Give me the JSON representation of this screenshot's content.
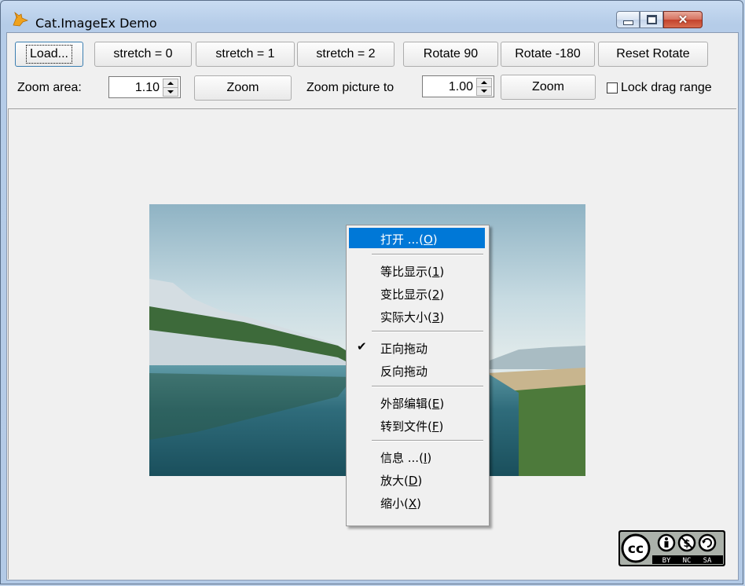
{
  "window": {
    "title": "Cat.ImageEx Demo",
    "controls": {
      "minimize": "minimize",
      "maximize": "maximize",
      "close": "✕"
    }
  },
  "toolbar": {
    "load_label": "Load...",
    "stretch0_label": "stretch = 0",
    "stretch1_label": "stretch = 1",
    "stretch2_label": "stretch = 2",
    "rotate90_label": "Rotate 90",
    "rotate_neg180_label": "Rotate -180",
    "reset_rotate_label": "Reset Rotate"
  },
  "zoom_row": {
    "zoom_area_label": "Zoom area:",
    "zoom_area_value": "1.10",
    "zoom_button_label": "Zoom",
    "zoom_picture_label": "Zoom picture to",
    "zoom_picture_value": "1.00",
    "zoom_picture_button_label": "Zoom",
    "lock_drag_label": "Lock drag range",
    "lock_drag_checked": false
  },
  "context_menu": {
    "items": [
      {
        "label": "打开 ...(",
        "key": "O",
        "suffix": ")",
        "highlighted": true,
        "checked": false
      },
      {
        "label": "等比显示(",
        "key": "1",
        "suffix": ")",
        "highlighted": false,
        "checked": false
      },
      {
        "label": "变比显示(",
        "key": "2",
        "suffix": ")",
        "highlighted": false,
        "checked": false
      },
      {
        "label": "实际大小(",
        "key": "3",
        "suffix": ")",
        "highlighted": false,
        "checked": false
      },
      {
        "label": "正向拖动",
        "key": "",
        "suffix": "",
        "highlighted": false,
        "checked": true
      },
      {
        "label": "反向拖动",
        "key": "",
        "suffix": "",
        "highlighted": false,
        "checked": false
      },
      {
        "label": "外部编辑(",
        "key": "E",
        "suffix": ")",
        "highlighted": false,
        "checked": false
      },
      {
        "label": "转到文件(",
        "key": "F",
        "suffix": ")",
        "highlighted": false,
        "checked": false
      },
      {
        "label": "信息 ...(",
        "key": "I",
        "suffix": ")",
        "highlighted": false,
        "checked": false
      },
      {
        "label": "放大(",
        "key": "D",
        "suffix": ")",
        "highlighted": false,
        "checked": false
      },
      {
        "label": "缩小(",
        "key": "X",
        "suffix": ")",
        "highlighted": false,
        "checked": false
      }
    ],
    "check_glyph": "✔"
  },
  "license_badge": {
    "cc": "cc",
    "by": "BY",
    "nc": "NC",
    "sa": "SA"
  },
  "picture": {
    "subject": "landscape-lake-photo"
  }
}
